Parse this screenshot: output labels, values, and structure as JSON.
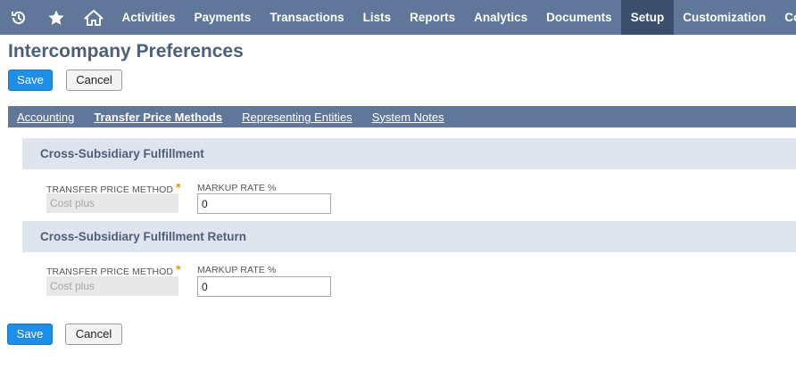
{
  "nav": {
    "icons": [
      "history-icon",
      "star-icon",
      "home-icon"
    ],
    "items": [
      {
        "label": "Activities"
      },
      {
        "label": "Payments"
      },
      {
        "label": "Transactions"
      },
      {
        "label": "Lists"
      },
      {
        "label": "Reports"
      },
      {
        "label": "Analytics"
      },
      {
        "label": "Documents"
      },
      {
        "label": "Setup",
        "active": true
      },
      {
        "label": "Customization"
      },
      {
        "label": "Co"
      }
    ]
  },
  "page": {
    "title": "Intercompany Preferences"
  },
  "buttons": {
    "save": "Save",
    "cancel": "Cancel"
  },
  "subtabs": [
    {
      "label": "Accounting"
    },
    {
      "label": "Transfer Price Methods",
      "active": true
    },
    {
      "label": "Representing Entities"
    },
    {
      "label": "System Notes"
    }
  ],
  "sections": [
    {
      "title": "Cross-Subsidiary Fulfillment",
      "transfer_price_label": "TRANSFER PRICE METHOD",
      "transfer_price_value": "Cost plus",
      "markup_label": "MARKUP RATE %",
      "markup_value": "0"
    },
    {
      "title": "Cross-Subsidiary Fulfillment Return",
      "transfer_price_label": "TRANSFER PRICE METHOD",
      "transfer_price_value": "Cost plus",
      "markup_label": "MARKUP RATE %",
      "markup_value": "0"
    }
  ],
  "required_marker": "*",
  "colors": {
    "nav_bg": "#607799",
    "nav_active": "#3b4e6b",
    "primary_button": "#1e8ee8",
    "section_bg": "#dfe4ee",
    "title_text": "#4d5f79",
    "required": "#e89a0a"
  }
}
